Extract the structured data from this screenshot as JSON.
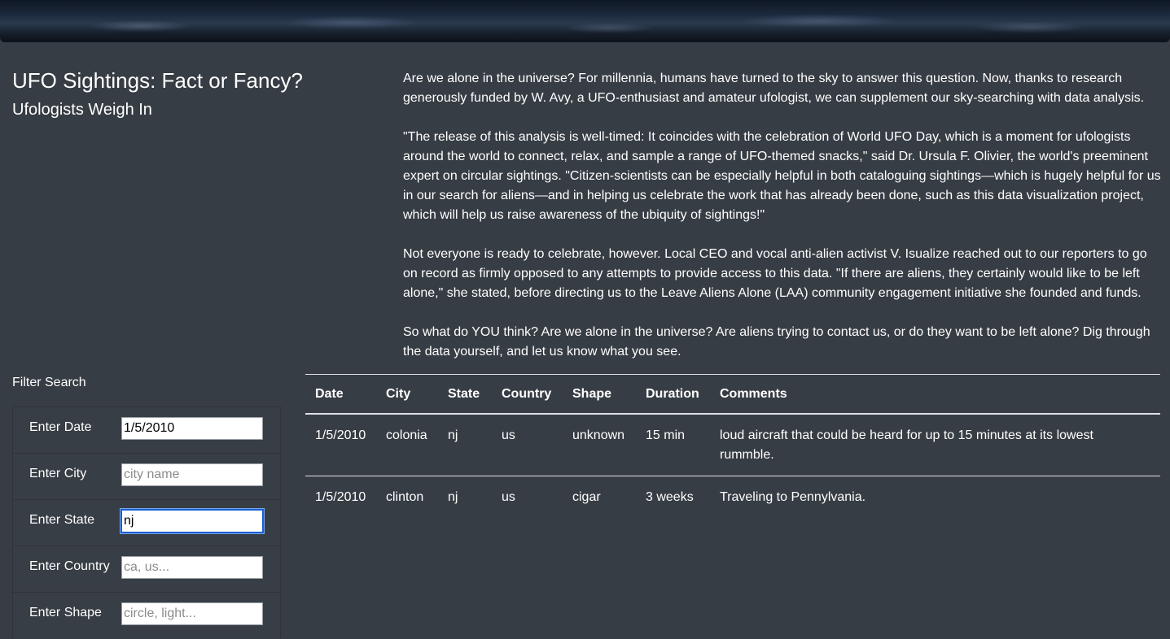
{
  "header": {
    "title": "UFO Sightings: Fact or Fancy?",
    "subtitle": "Ufologists Weigh In"
  },
  "article": {
    "paragraphs": [
      "Are we alone in the universe? For millennia, humans have turned to the sky to answer this question. Now, thanks to research generously funded by W. Avy, a UFO-enthusiast and amateur ufologist, we can supplement our sky-searching with data analysis.",
      "\"The release of this analysis is well-timed: It coincides with the celebration of World UFO Day, which is a moment for ufologists around the world to connect, relax, and sample a range of UFO-themed snacks,\" said Dr. Ursula F. Olivier, the world's preeminent expert on circular sightings. \"Citizen-scientists can be especially helpful in both cataloguing sightings—which is hugely helpful for us in our search for aliens—and in helping us celebrate the work that has already been done, such as this data visualization project, which will help us raise awareness of the ubiquity of sightings!\"",
      "Not everyone is ready to celebrate, however. Local CEO and vocal anti-alien activist V. Isualize reached out to our reporters to go on record as firmly opposed to any attempts to provide access to this data. \"If there are aliens, they certainly would like to be left alone,\" she stated, before directing us to the Leave Aliens Alone (LAA) community engagement initiative she founded and funds.",
      "So what do YOU think? Are we alone in the universe? Are aliens trying to contact us, or do they want to be left alone? Dig through the data yourself, and let us know what you see."
    ]
  },
  "filters": {
    "heading": "Filter Search",
    "items": [
      {
        "label": "Enter Date",
        "value": "1/5/2010",
        "placeholder": ""
      },
      {
        "label": "Enter City",
        "value": "",
        "placeholder": "city name"
      },
      {
        "label": "Enter State",
        "value": "nj",
        "placeholder": ""
      },
      {
        "label": "Enter Country",
        "value": "",
        "placeholder": "ca, us..."
      },
      {
        "label": "Enter Shape",
        "value": "",
        "placeholder": "circle, light..."
      }
    ]
  },
  "table": {
    "headers": [
      "Date",
      "City",
      "State",
      "Country",
      "Shape",
      "Duration",
      "Comments"
    ],
    "rows": [
      [
        "1/5/2010",
        "colonia",
        "nj",
        "us",
        "unknown",
        "15 min",
        "loud aircraft that could be heard for up to 15 minutes at its lowest rummble."
      ],
      [
        "1/5/2010",
        "clinton",
        "nj",
        "us",
        "cigar",
        "3 weeks",
        "Traveling to Pennylvania."
      ]
    ]
  },
  "colors": {
    "page_background": "#373d44",
    "text": "#ffffff",
    "focus_outline": "#1a5fd0"
  }
}
